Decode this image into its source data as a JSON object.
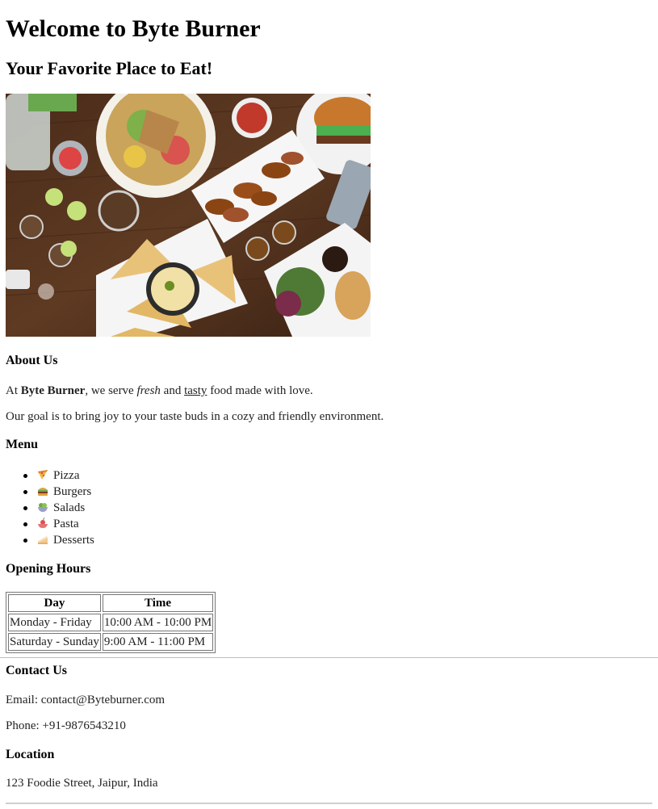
{
  "header": {
    "title": "Welcome to Byte Burner",
    "subtitle": "Your Favorite Place to Eat!"
  },
  "about": {
    "heading": "About Us",
    "line1_prefix": "At ",
    "line1_brand": "Byte Burner",
    "line1_mid": ", we serve ",
    "line1_fresh": "fresh",
    "line1_and": " and ",
    "line1_tasty": "tasty",
    "line1_suffix": " food made with love.",
    "line2": "Our goal is to bring joy to your taste buds in a cozy and friendly environment."
  },
  "menu": {
    "heading": "Menu",
    "items": [
      {
        "label": "Pizza",
        "icon": "pizza-icon"
      },
      {
        "label": "Burgers",
        "icon": "burger-icon"
      },
      {
        "label": "Salads",
        "icon": "salad-icon"
      },
      {
        "label": "Pasta",
        "icon": "pasta-icon"
      },
      {
        "label": "Desserts",
        "icon": "dessert-icon"
      }
    ]
  },
  "hours": {
    "heading": "Opening Hours",
    "columns": [
      "Day",
      "Time"
    ],
    "rows": [
      [
        "Monday - Friday",
        "10:00 AM - 10:00 PM"
      ],
      [
        "Saturday - Sunday",
        "9:00 AM - 11:00 PM"
      ]
    ]
  },
  "contact": {
    "heading": "Contact Us",
    "email": "Email: contact@Byteburner.com",
    "phone": "Phone: +91-9876543210"
  },
  "location": {
    "heading": "Location",
    "address": "123 Foodie Street, Jaipur, India"
  }
}
